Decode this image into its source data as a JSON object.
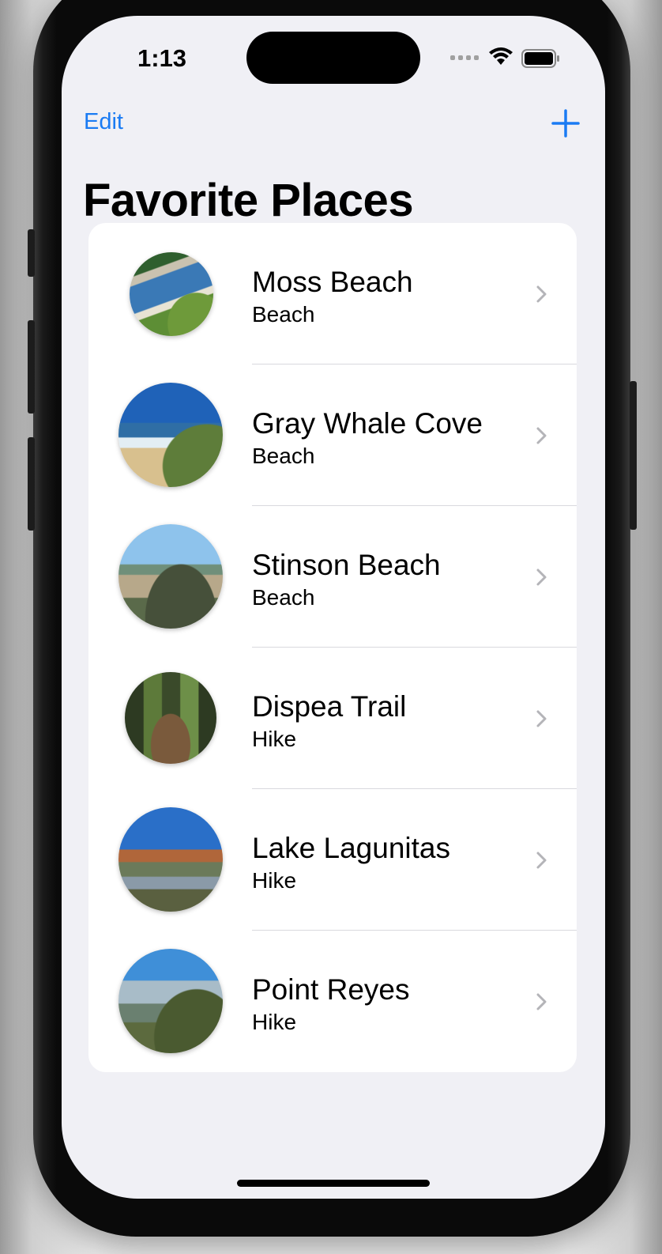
{
  "status_bar": {
    "time": "1:13"
  },
  "nav": {
    "edit_label": "Edit",
    "add_icon": "plus-icon"
  },
  "title": "Favorite Places",
  "places": [
    {
      "name": "Moss Beach",
      "type": "Beach"
    },
    {
      "name": "Gray Whale Cove",
      "type": "Beach"
    },
    {
      "name": "Stinson Beach",
      "type": "Beach"
    },
    {
      "name": "Dispea Trail",
      "type": "Hike"
    },
    {
      "name": "Lake Lagunitas",
      "type": "Hike"
    },
    {
      "name": "Point Reyes",
      "type": "Hike"
    }
  ],
  "colors": {
    "accent": "#1a7bf3",
    "background": "#f0f0f5",
    "card": "#ffffff"
  }
}
